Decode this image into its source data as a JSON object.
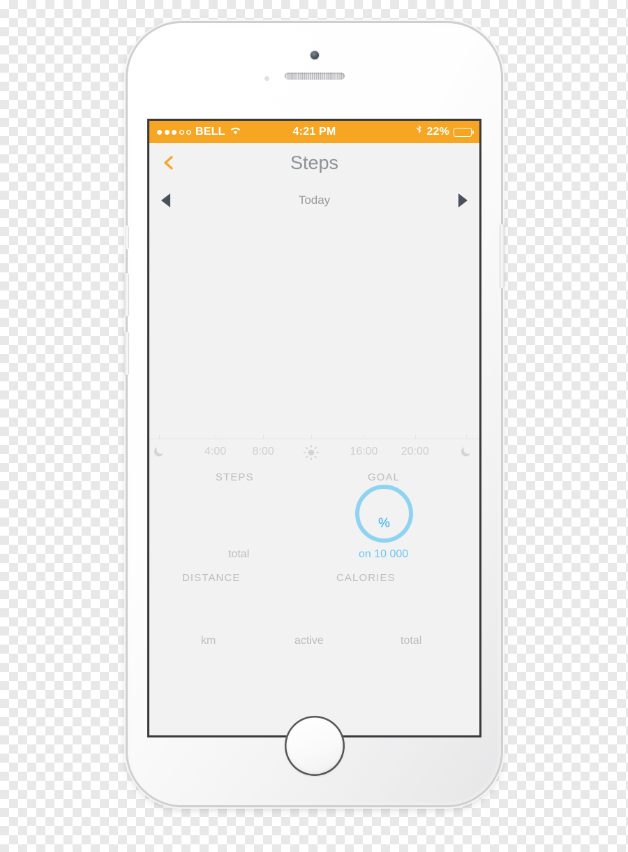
{
  "device": {
    "name": "iphone-5s-white",
    "hardware": {
      "camera": "front-camera",
      "sensor": "proximity-sensor",
      "speaker": "earpiece-speaker",
      "home_button": "home-button",
      "volume_up": "volume-up-button",
      "volume_down": "volume-down-button",
      "mute_switch": "mute-switch",
      "power": "power-button"
    }
  },
  "statusbar": {
    "signal_dots_filled": 3,
    "signal_dots_total": 5,
    "carrier": "BELL",
    "wifi_icon": "wifi-icon",
    "time": "4:21 PM",
    "bluetooth_icon": "bluetooth-icon",
    "battery_percent": "22%",
    "battery_level": 22,
    "background_color": "#F6A623",
    "text_color": "#FFFFFF"
  },
  "navbar": {
    "back_icon": "chevron-left-icon",
    "back_color": "#F6A623",
    "title": "Steps",
    "title_color": "#8D9299"
  },
  "dayselector": {
    "prev_icon": "triangle-left-icon",
    "label": "Today",
    "next_icon": "triangle-right-icon",
    "arrow_color": "#4A515B"
  },
  "chart_data": {
    "type": "bar",
    "title": "Steps",
    "xlabel": "",
    "ylabel": "",
    "categories": [
      "4:00",
      "8:00",
      "16:00",
      "20:00"
    ],
    "values": [],
    "series": [
      {
        "name": "steps",
        "values": []
      }
    ],
    "axis": {
      "ticks": [
        {
          "label": "",
          "icon": "moon-icon",
          "pos_pct": 3
        },
        {
          "label": "4:00",
          "icon": "",
          "pos_pct": 20
        },
        {
          "label": "8:00",
          "icon": "",
          "pos_pct": 34.5
        },
        {
          "label": "",
          "icon": "sun-icon",
          "pos_pct": 49
        },
        {
          "label": "16:00",
          "icon": "",
          "pos_pct": 65
        },
        {
          "label": "20:00",
          "icon": "",
          "pos_pct": 80.5
        },
        {
          "label": "",
          "icon": "moon-icon",
          "pos_pct": 96
        }
      ],
      "grid": false,
      "axis_line_color": "#E2E2E2",
      "label_color": "#CFCFCF"
    },
    "legend": [],
    "note": "chart plot area is empty - no step data recorded"
  },
  "stats": {
    "steps": {
      "heading": "STEPS",
      "value": "",
      "sub": "total"
    },
    "goal": {
      "heading": "GOAL",
      "percent_value": "",
      "percent_unit": "%",
      "sub": "on 10 000",
      "ring_color": "#8ED4F2",
      "pct_text_color": "#2BACEC",
      "sub_color": "#6EC6EF"
    },
    "distance": {
      "heading": "DISTANCE",
      "value": "",
      "sub": "km"
    },
    "calories": {
      "heading": "CALORIES",
      "active_value": "",
      "active_sub": "active",
      "total_value": "",
      "total_sub": "total"
    },
    "heading_color": "#BDBDBD",
    "sub_color": "#BDBDBD"
  },
  "screen": {
    "background_color": "#F2F2F2"
  }
}
